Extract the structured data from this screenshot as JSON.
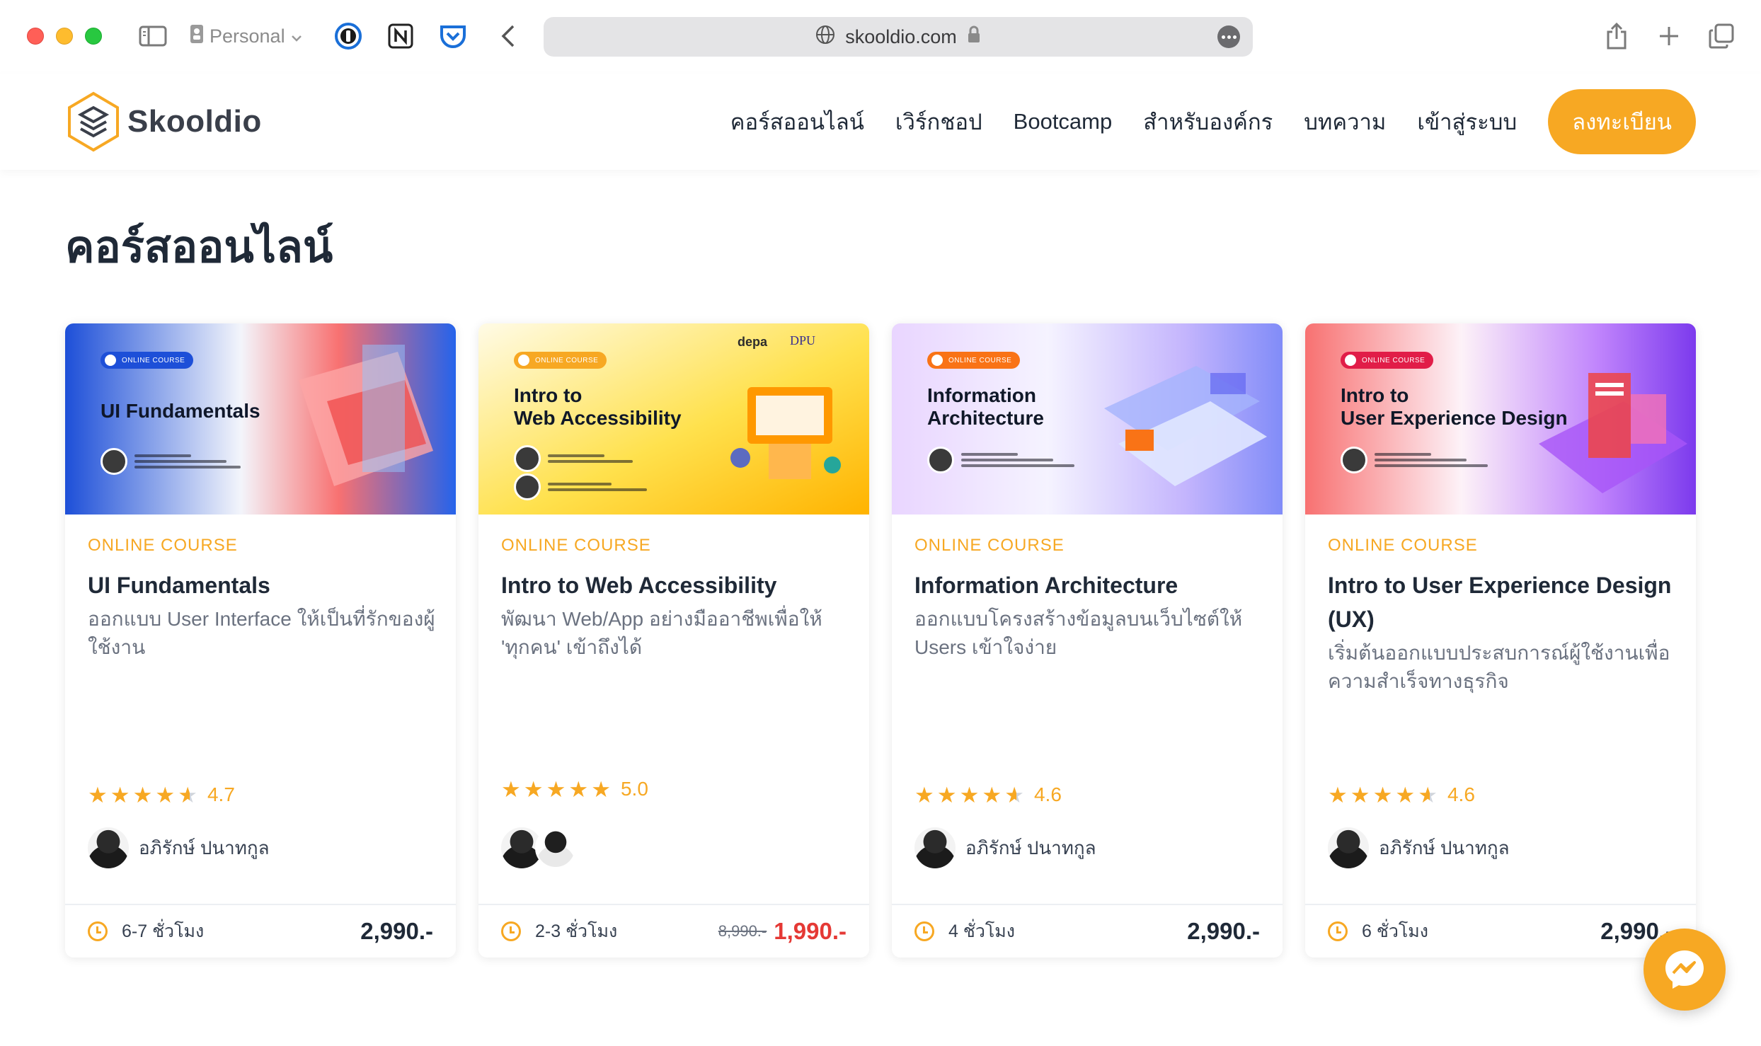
{
  "browser": {
    "profile_label": "Personal",
    "url": "skooldio.com"
  },
  "header": {
    "logo_text": "Skooldio",
    "nav": [
      "คอร์สออนไลน์",
      "เวิร์กชอป",
      "Bootcamp",
      "สำหรับองค์กร",
      "บทความ",
      "เข้าสู่ระบบ"
    ],
    "register_label": "ลงทะเบียน"
  },
  "page": {
    "title": "คอร์สออนไลน์"
  },
  "courses": [
    {
      "thumb_badge": "ONLINE COURSE",
      "thumb_title": "UI Fundamentals",
      "category": "ONLINE COURSE",
      "title": "UI Fundamentals",
      "description": "ออกแบบ User Interface ให้เป็นที่รักของผู้ใช้งาน",
      "rating": "4.7",
      "rating_value": 4.7,
      "instructor": "อภิรักษ์ ปนาทกูล",
      "duration": "6-7 ชั่วโมง",
      "price": "2,990.-"
    },
    {
      "thumb_badge": "ONLINE COURSE",
      "thumb_title": "Intro to\nWeb Accessibility",
      "thumb_partner": "depa",
      "thumb_partner2": "DPU",
      "category": "ONLINE COURSE",
      "title": "Intro to Web Accessibility",
      "description": "พัฒนา Web/App อย่างมืออาชีพเพื่อให้ 'ทุกคน' เข้าถึงได้",
      "rating": "5.0",
      "rating_value": 5.0,
      "duration": "2-3 ชั่วโมง",
      "old_price": "8,990.-",
      "price": "1,990.-"
    },
    {
      "thumb_badge": "ONLINE COURSE",
      "thumb_title": "Information\nArchitecture",
      "category": "ONLINE COURSE",
      "title": "Information Architecture",
      "description": "ออกแบบโครงสร้างข้อมูลบนเว็บไซต์ให้ Users เข้าใจง่าย",
      "rating": "4.6",
      "rating_value": 4.6,
      "instructor": "อภิรักษ์ ปนาทกูล",
      "duration": "4 ชั่วโมง",
      "price": "2,990.-"
    },
    {
      "thumb_badge": "ONLINE COURSE",
      "thumb_title": "Intro to\nUser Experience Design",
      "category": "ONLINE COURSE",
      "title": "Intro to User Experience Design (UX)",
      "description": "เริ่มต้นออกแบบประสบการณ์ผู้ใช้งานเพื่อความสำเร็จทางธุรกิจ",
      "rating": "4.6",
      "rating_value": 4.6,
      "instructor": "อภิรักษ์ ปนาทกูล",
      "duration": "6 ชั่วโมง",
      "price": "2,990.-"
    }
  ],
  "colors": {
    "accent": "#f7a823",
    "sale": "#e53935",
    "text": "#1f2937",
    "muted": "#6b7280"
  },
  "icons": [
    "sidebar-toggle-icon",
    "person-icon",
    "chevron-down-icon",
    "password-manager-icon",
    "notion-icon",
    "pocket-icon",
    "back-arrow-icon",
    "globe-icon",
    "lock-icon",
    "more-icon",
    "share-icon",
    "plus-icon",
    "tabs-icon",
    "clock-icon",
    "star-icon",
    "messenger-icon"
  ]
}
